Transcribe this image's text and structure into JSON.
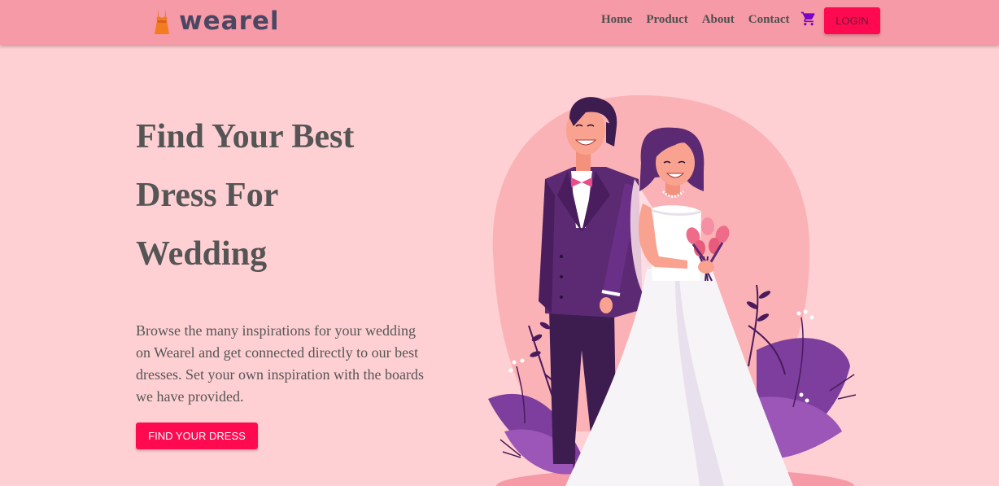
{
  "brand": {
    "name": "wearel"
  },
  "nav": {
    "links": [
      "Home",
      "Product",
      "About",
      "Contact"
    ],
    "login_label": "LOGIN"
  },
  "hero": {
    "title_lines": [
      "Find Your Best",
      "Dress For",
      "Wedding"
    ],
    "description": "Browse the many inspirations for your wedding on Wearel and get connected directly to our best dresses. Set your own inspiration with the boards we have provided.",
    "cta_label": "FIND YOUR DRESS"
  },
  "colors": {
    "page_bg": "#ffd0d3",
    "navbar_bg": "#f59aa6",
    "accent": "#ff0a50",
    "text": "#555555",
    "logo_text": "#4b4763"
  },
  "icons": {
    "logo": "dress-icon",
    "cart": "shopping-cart-icon"
  }
}
